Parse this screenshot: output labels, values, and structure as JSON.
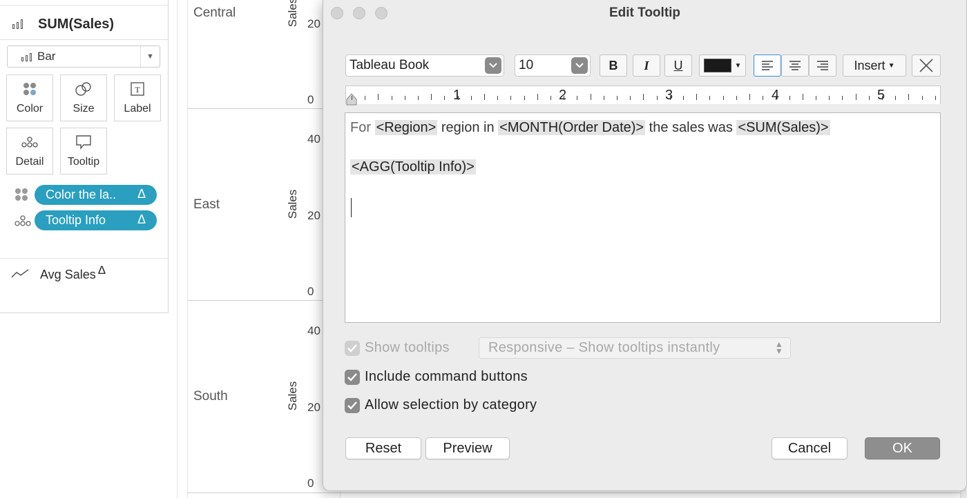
{
  "marks_card": {
    "header": {
      "icon": "bar-chart-icon",
      "title": "SUM(Sales)"
    },
    "mark_type": {
      "icon": "bar-chart-icon",
      "value": "Bar"
    },
    "buttons": [
      {
        "label": "Color",
        "icon": "color-icon"
      },
      {
        "label": "Size",
        "icon": "size-icon"
      },
      {
        "label": "Label",
        "icon": "label-icon"
      },
      {
        "label": "Detail",
        "icon": "detail-icon"
      },
      {
        "label": "Tooltip",
        "icon": "tooltip-icon"
      }
    ],
    "pills": [
      {
        "label": "Color the la..",
        "suffix": "Δ",
        "icon": "color-icon",
        "color": "#2a9fc0"
      },
      {
        "label": "Tooltip Info",
        "suffix": "Δ",
        "icon": "detail-icon",
        "color": "#2a9fc0"
      }
    ],
    "avg": {
      "icon": "line-chart-icon",
      "label": "Avg Sales",
      "suffix": "Δ"
    }
  },
  "view": {
    "regions": [
      "Central",
      "East",
      "South"
    ],
    "axis_label": "Sales",
    "ticks": {
      "c_top": "20",
      "c_bottom": "0",
      "e_top": "40",
      "e_mid": "20",
      "e_bottom": "0",
      "s_top": "40",
      "s_mid": "20",
      "s_bottom": "0"
    }
  },
  "dialog": {
    "title": "Edit Tooltip",
    "font": "Tableau Book",
    "size": "10",
    "bold": "B",
    "italic": "I",
    "underline": "U",
    "font_color": "#1a1a1a",
    "insert": "Insert",
    "ruler": [
      "1",
      "2",
      "3",
      "4",
      "5"
    ],
    "text": {
      "line1": {
        "p1": "For ",
        "f1": "<Region>",
        "p2": " region in ",
        "f2": "<MONTH(Order Date)>",
        "p3": " the sales was ",
        "f3": "<SUM(Sales)>"
      },
      "line2": {
        "f1": "<AGG(Tooltip Info)>"
      }
    },
    "show_tooltips": {
      "label": "Show tooltips",
      "checked": true,
      "disabled": true
    },
    "responsive": "Responsive – Show tooltips instantly",
    "include_cmd": {
      "label": "Include command buttons",
      "checked": true
    },
    "allow_sel": {
      "label": "Allow selection by category",
      "checked": true
    },
    "reset": "Reset",
    "preview": "Preview",
    "cancel": "Cancel",
    "ok": "OK"
  }
}
